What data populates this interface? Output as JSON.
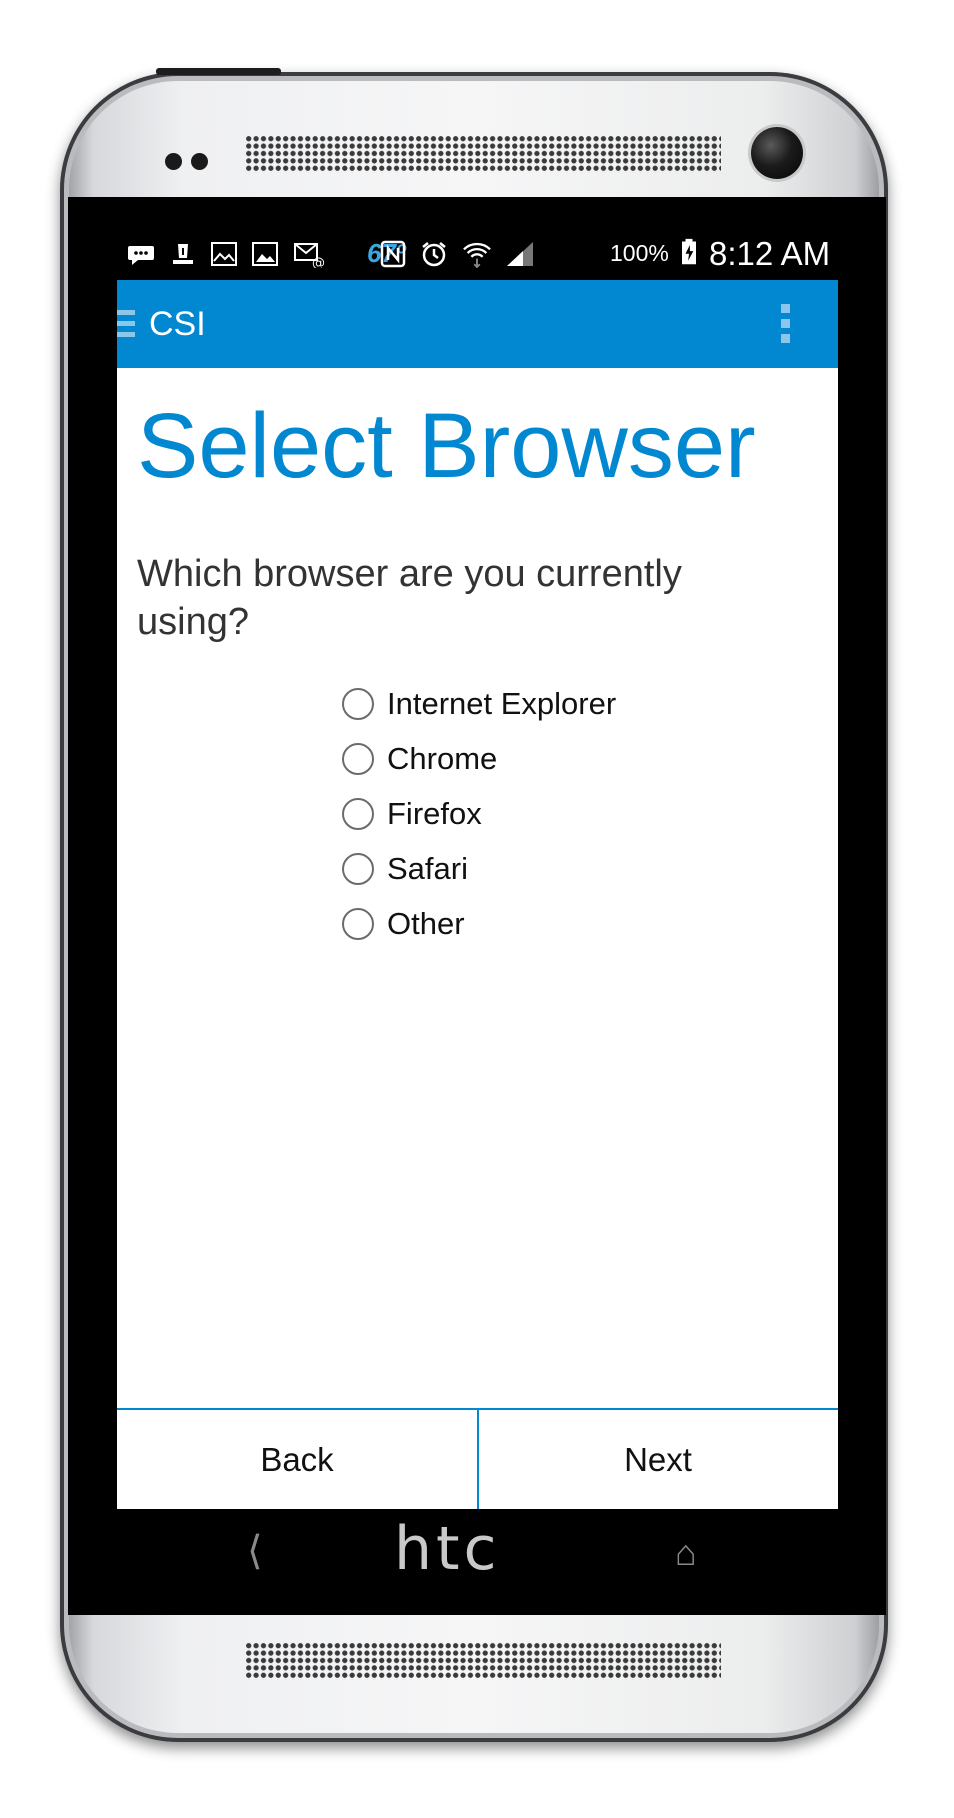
{
  "device": {
    "brand": "htc"
  },
  "statusbar": {
    "temperature": "67º",
    "battery_percent": "100%",
    "time": "8:12 AM",
    "icons": [
      "messaging-icon",
      "alert-icon",
      "gallery-icon",
      "image-icon",
      "email-icon",
      "nfc-icon",
      "alarm-icon",
      "wifi-icon",
      "signal-icon",
      "battery-charging-icon"
    ]
  },
  "appbar": {
    "title": "CSI",
    "icons": [
      "menu-icon",
      "overflow-menu-icon"
    ],
    "color": "#0288d1"
  },
  "page": {
    "title": "Select Browser",
    "question": "Which browser are you currently using?"
  },
  "options": [
    {
      "label": "Internet Explorer",
      "selected": false
    },
    {
      "label": "Chrome",
      "selected": false
    },
    {
      "label": "Firefox",
      "selected": false
    },
    {
      "label": "Safari",
      "selected": false
    },
    {
      "label": "Other",
      "selected": false
    }
  ],
  "buttons": {
    "back": "Back",
    "next": "Next"
  },
  "navbar": {
    "icons": [
      "back-nav-icon",
      "home-nav-icon"
    ]
  }
}
